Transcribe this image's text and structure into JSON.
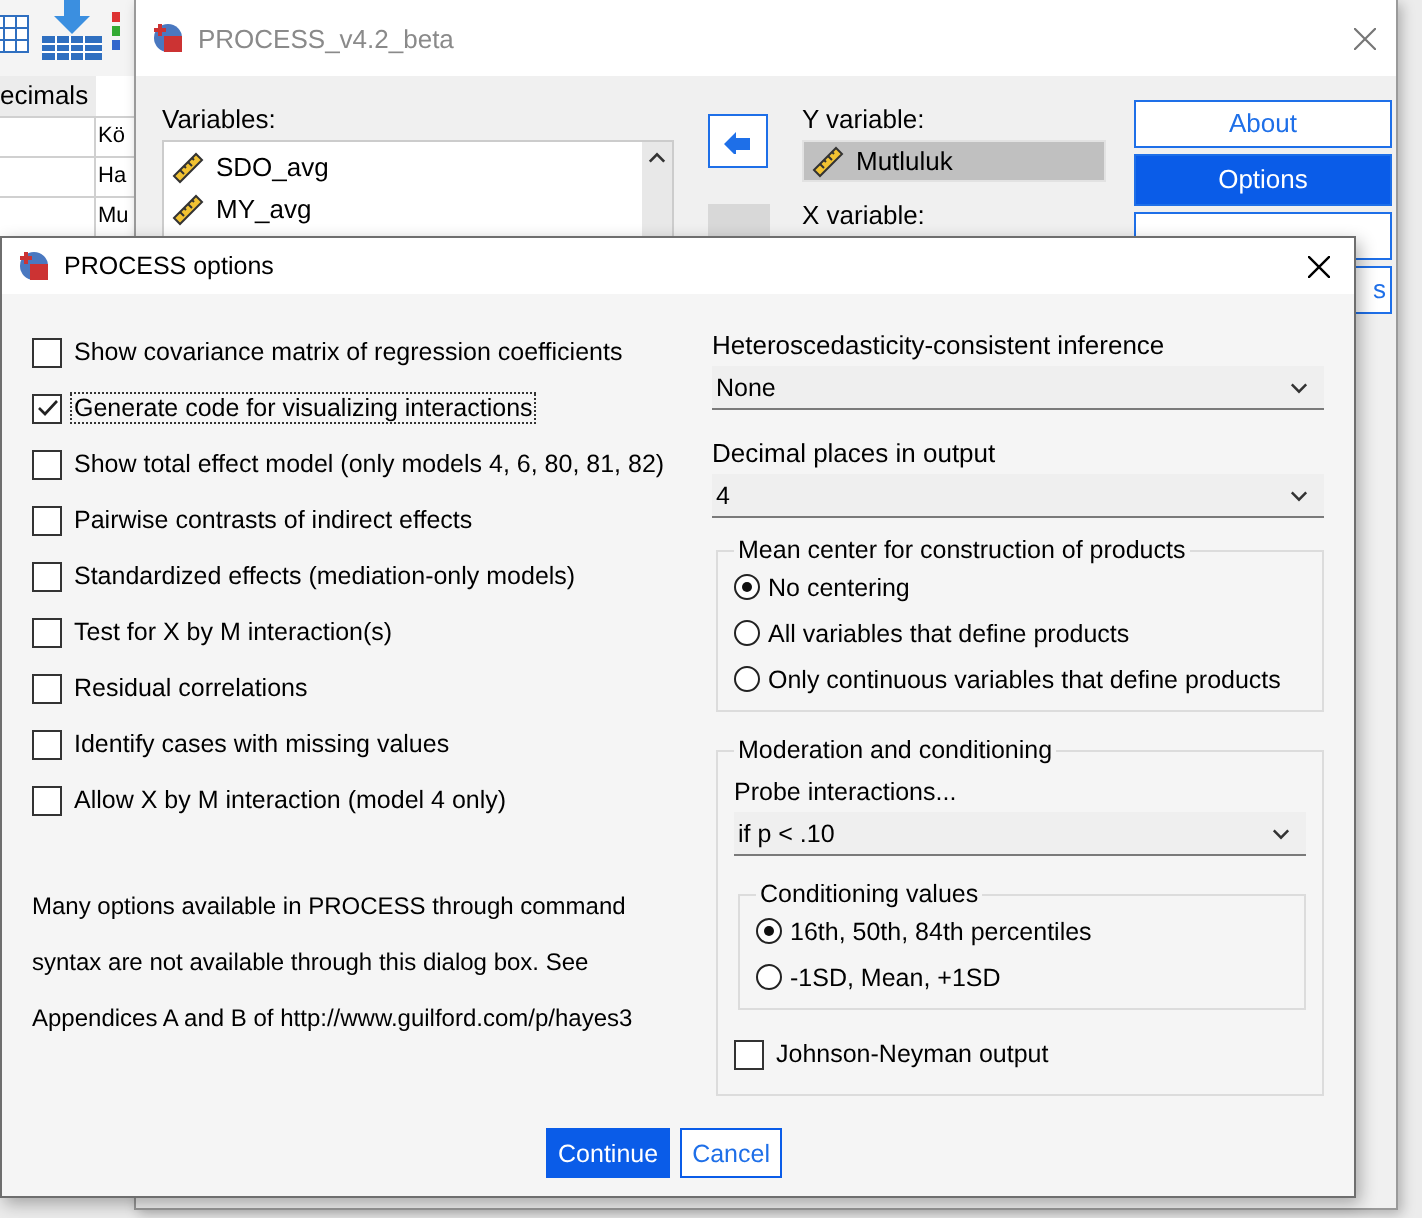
{
  "background_app": {
    "grid_header": "ecimals",
    "grid_cells": [
      "Kö",
      "Ha",
      "Mu"
    ]
  },
  "process_window": {
    "title": "PROCESS_v4.2_beta",
    "variables_label": "Variables:",
    "variables": [
      {
        "name": "SDO_avg"
      },
      {
        "name": "MY_avg"
      }
    ],
    "y_variable_label": "Y variable:",
    "y_variable": "Mutluluk",
    "x_variable_label": "X variable:",
    "buttons": [
      {
        "label": "About",
        "selected": false
      },
      {
        "label": "Options",
        "selected": true
      }
    ],
    "partial_button": "s"
  },
  "options_dialog": {
    "title": "PROCESS options",
    "checkboxes": [
      {
        "label": "Show covariance matrix of regression coefficients",
        "checked": false,
        "focused": false
      },
      {
        "label": "Generate code for visualizing interactions",
        "checked": true,
        "focused": true
      },
      {
        "label": "Show total effect model (only models 4, 6, 80, 81, 82)",
        "checked": false,
        "focused": false
      },
      {
        "label": "Pairwise contrasts of indirect effects",
        "checked": false,
        "focused": false
      },
      {
        "label": "Standardized effects (mediation-only models)",
        "checked": false,
        "focused": false
      },
      {
        "label": "Test for X by M interaction(s)",
        "checked": false,
        "focused": false
      },
      {
        "label": "Residual correlations",
        "checked": false,
        "focused": false
      },
      {
        "label": "Identify cases with missing values",
        "checked": false,
        "focused": false
      },
      {
        "label": "Allow X by M interaction (model 4 only)",
        "checked": false,
        "focused": false
      }
    ],
    "note_lines": [
      "Many options available in PROCESS through command",
      "syntax are not available through this dialog box.  See",
      "Appendices A and B of http://www.guilford.com/p/hayes3"
    ],
    "heteroscedasticity": {
      "label": "Heteroscedasticity-consistent inference",
      "value": "None"
    },
    "decimal_places": {
      "label": "Decimal places in output",
      "value": "4"
    },
    "mean_center": {
      "title": "Mean center for construction of products",
      "options": [
        {
          "label": "No centering",
          "selected": true
        },
        {
          "label": "All variables that define products",
          "selected": false
        },
        {
          "label": "Only continuous variables that define products",
          "selected": false
        }
      ]
    },
    "moderation": {
      "title": "Moderation and conditioning",
      "probe_label": "Probe interactions...",
      "probe_value": "if p < .10",
      "conditioning": {
        "title": "Conditioning values",
        "options": [
          {
            "label": "16th, 50th, 84th percentiles",
            "selected": true
          },
          {
            "label": "-1SD, Mean, +1SD",
            "selected": false
          }
        ]
      },
      "johnson_neyman": {
        "label": "Johnson-Neyman output",
        "checked": false
      }
    },
    "buttons": [
      {
        "label": "Continue",
        "default": true
      },
      {
        "label": "Cancel",
        "default": false
      }
    ]
  }
}
